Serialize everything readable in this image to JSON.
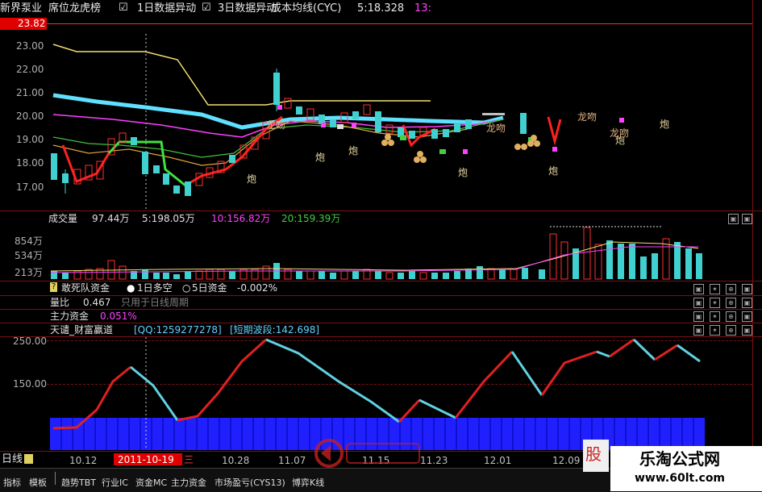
{
  "header": {
    "stock_name": "新界泵业",
    "menu_label": "席位龙虎榜",
    "check1_label": "1日数据异动",
    "check2_label": "3日数据异动",
    "check2_suffix": "成本均线(CYC)",
    "price_info": "5:18.328",
    "extra": "13:",
    "current_price": "23.82",
    "checkbox_glyph": "☑"
  },
  "price_axis": [
    "23.00",
    "22.00",
    "21.00",
    "20.00",
    "19.00",
    "18.00",
    "17.00"
  ],
  "price_markers": {
    "pao": "炮",
    "longwen": "龙吻"
  },
  "volume_panel": {
    "title": "成交量",
    "vol": "97.44万",
    "ma5": "5:198.05万",
    "ma10": "10:156.82万",
    "ma20": "20:159.39万",
    "axis": [
      "854万",
      "534万",
      "213万"
    ]
  },
  "indicator_rows": [
    {
      "label": "敢死队资金",
      "a": "1日多空",
      "b": "5日资金",
      "c": "-0.002%"
    },
    {
      "label": "量比",
      "value": "0.467",
      "note": "只用于日线周期"
    },
    {
      "label": "主力资金",
      "value": "0.051%"
    },
    {
      "label": "天谴_财富赢道",
      "qq": "[QQ:1259277278]",
      "wave": "[短期波段:142.698]"
    }
  ],
  "osc_axis": [
    "250.00",
    "150.00"
  ],
  "date_axis": [
    "10.12",
    "10.19",
    "10.28",
    "11.07",
    "11.15",
    "11.23",
    "12.01",
    "12.09"
  ],
  "cursor_date": "2011-10-19",
  "cursor_day_suffix": "三",
  "period_label": "日线",
  "bottom_tabs": [
    "指标",
    "模板",
    "趋势TBT",
    "行业IC",
    "资金MC",
    "主力资金",
    "市场盈亏(CYS13)",
    "博弈K线"
  ],
  "watermark": {
    "brand": "乐淘公式网",
    "url": "www.60lt.com",
    "side": "股"
  },
  "colors": {
    "bg": "#000000",
    "up": "#ff3030",
    "down": "#40d0d0",
    "ma_yellow": "#f0e070",
    "ma_cyan": "#60e0ff",
    "ma_magenta": "#ff40ff",
    "separator": "#7a1010"
  }
}
